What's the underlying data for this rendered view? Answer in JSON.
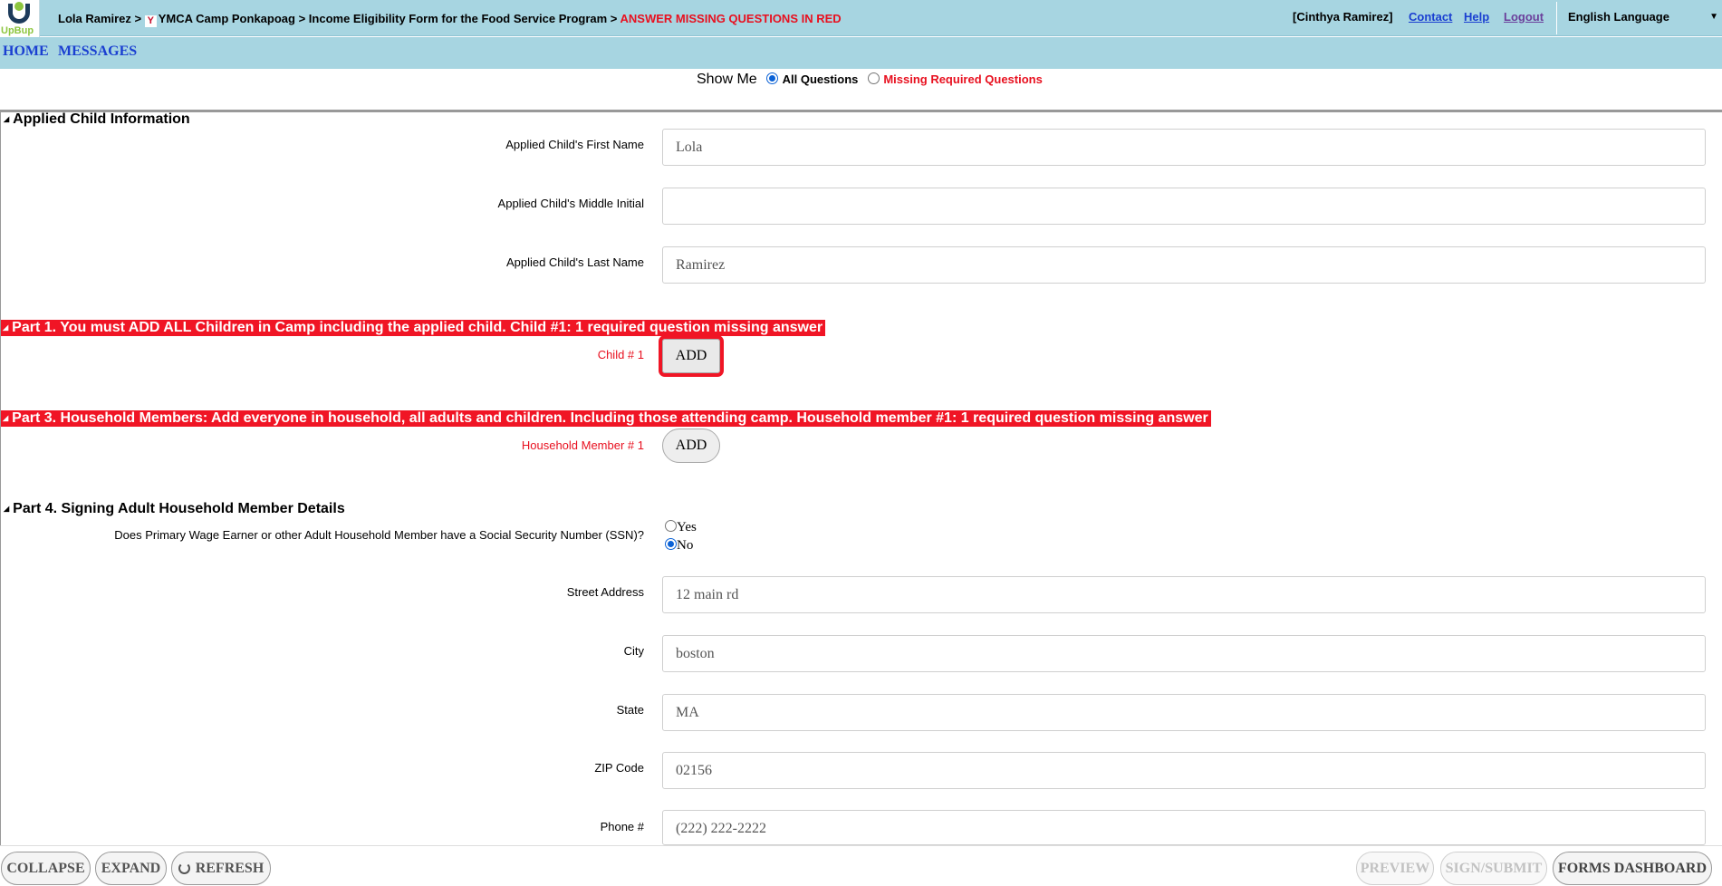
{
  "header": {
    "logo_text": "UpBup",
    "breadcrumb": {
      "child": "Lola Ramirez",
      "sep1": " > ",
      "ymca_glyph": "Y",
      "camp": "YMCA Camp Ponkapoag",
      "sep2": " > ",
      "form": "Income Eligibility Form for the Food Service Program",
      "sep3": " > ",
      "alert": "ANSWER MISSING QUESTIONS IN RED"
    },
    "user": "[Cinthya Ramirez]",
    "contact": "Contact",
    "help": "Help",
    "logout": "Logout",
    "language": "English Language"
  },
  "nav": {
    "home": "HOME",
    "messages": "MESSAGES"
  },
  "show_me": {
    "label": "Show Me",
    "all": "All Questions",
    "missing": "Missing Required Questions",
    "selected": "all"
  },
  "sections": {
    "applied_child": {
      "title": "Applied Child Information",
      "first_name_label": "Applied Child's First Name",
      "first_name_value": "Lola",
      "middle_initial_label": "Applied Child's Middle Initial",
      "middle_initial_value": "",
      "last_name_label": "Applied Child's Last Name",
      "last_name_value": "Ramirez"
    },
    "part1": {
      "title": "Part 1. You must ADD ALL Children in Camp including the applied child. Child #1: 1 required question missing answer",
      "child_label": "Child # 1",
      "add": "ADD"
    },
    "part3": {
      "title": "Part 3. Household Members: Add everyone in household, all adults and children. Including those attending camp. Household member #1: 1 required question missing answer",
      "member_label": "Household Member # 1",
      "add": "ADD"
    },
    "part4": {
      "title": "Part 4. Signing Adult Household Member Details",
      "ssn_question": "Does Primary Wage Earner or other Adult Household Member have a Social Security Number (SSN)?",
      "ssn_yes": "Yes",
      "ssn_no": "No",
      "ssn_selected": "No",
      "street_label": "Street Address",
      "street_value": "12 main rd",
      "city_label": "City",
      "city_value": "boston",
      "state_label": "State",
      "state_value": "MA",
      "zip_label": "ZIP Code",
      "zip_value": "02156",
      "phone_label": "Phone #",
      "phone_value": "(222) 222-2222"
    }
  },
  "footer": {
    "collapse": "COLLAPSE",
    "expand": "EXPAND",
    "refresh": "REFRESH",
    "preview": "PREVIEW",
    "sign_submit": "SIGN/SUBMIT",
    "forms_dashboard": "FORMS DASHBOARD"
  },
  "colors": {
    "header_bg": "#a7d5e1",
    "alert_red": "#f01525",
    "link_blue": "#1a3fd1"
  }
}
